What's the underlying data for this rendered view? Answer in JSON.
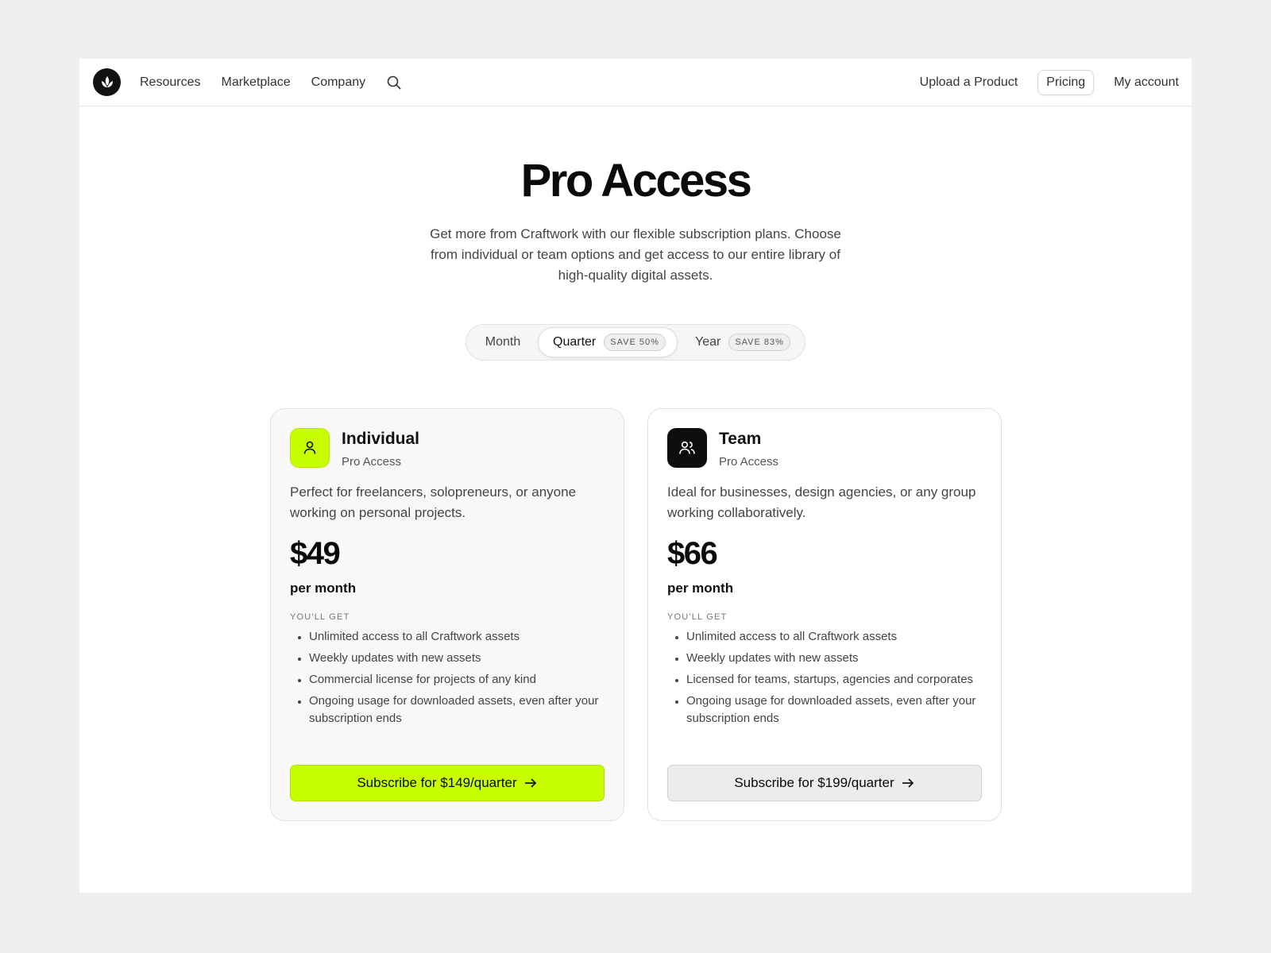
{
  "nav": {
    "logo": "leaf-logo",
    "left_links": [
      "Resources",
      "Marketplace",
      "Company"
    ],
    "search_icon": "search-icon",
    "right_links": {
      "upload": "Upload a Product",
      "pricing": "Pricing",
      "account": "My account"
    }
  },
  "hero": {
    "title": "Pro Access",
    "subtitle": "Get more from Craftwork with our flexible subscription plans. Choose from individual or team options and get access to our entire library of high-quality digital assets."
  },
  "billing_toggle": {
    "options": [
      {
        "label": "Month",
        "badge": ""
      },
      {
        "label": "Quarter",
        "badge": "SAVE 50%"
      },
      {
        "label": "Year",
        "badge": "SAVE 83%"
      }
    ],
    "selected": "Quarter"
  },
  "plans": [
    {
      "icon": "user-icon",
      "name": "Individual",
      "tier": "Pro Access",
      "description": "Perfect for freelancers, solopreneurs, or anyone working on personal projects.",
      "price": "$49",
      "period": "per month",
      "features_title": "YOU'LL GET",
      "features": [
        "Unlimited access to all Craftwork assets",
        "Weekly updates with new assets",
        "Commercial license for projects of any kind",
        "Ongoing usage for downloaded assets, even after your subscription ends"
      ],
      "cta": "Subscribe for $149/quarter",
      "accent": "#c8ff00"
    },
    {
      "icon": "users-icon",
      "name": "Team",
      "tier": "Pro Access",
      "description": "Ideal for businesses, design agencies, or any group working collaboratively.",
      "price": "$66",
      "period": "per month",
      "features_title": "YOU'LL GET",
      "features": [
        "Unlimited access to all Craftwork assets",
        "Weekly updates with new assets",
        "Licensed for teams, startups, agencies and corporates",
        "Ongoing usage for downloaded assets, even after your subscription ends"
      ],
      "cta": "Subscribe for $199/quarter",
      "accent": "#ececec"
    }
  ],
  "colors": {
    "accent": "#c8ff00",
    "dark": "#0e0e0e",
    "background": "#efefef"
  }
}
